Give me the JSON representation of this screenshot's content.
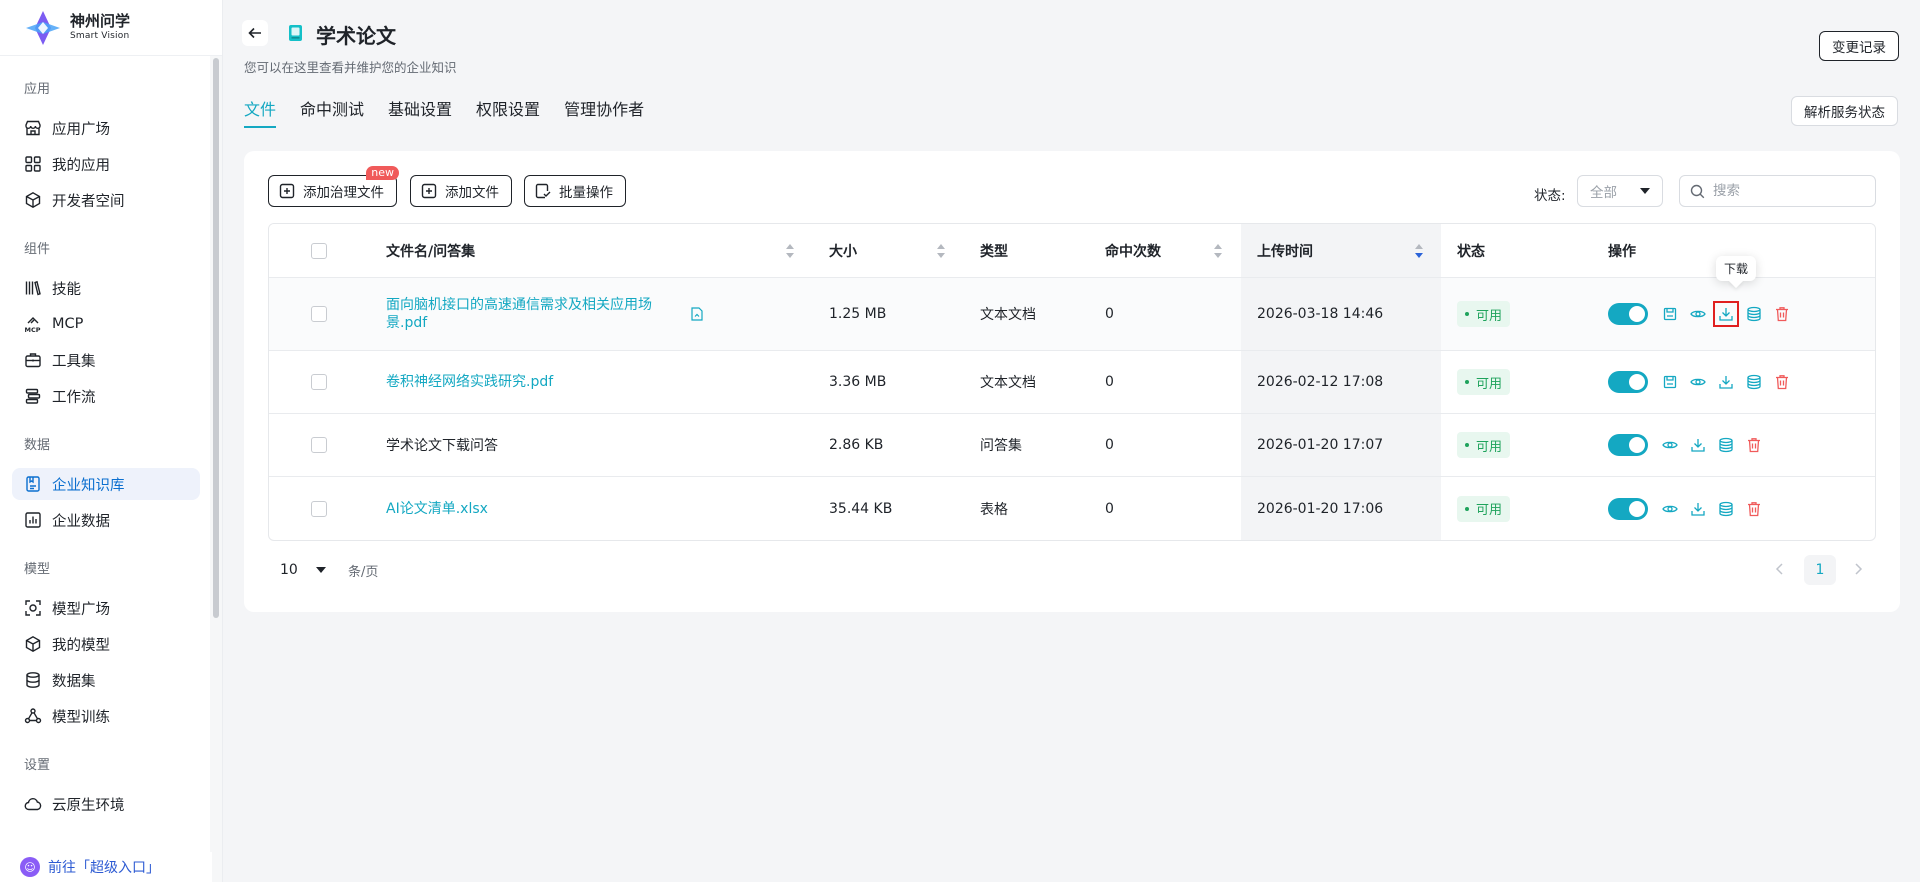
{
  "brand": {
    "name_cn": "神州问学",
    "name_en": "Smart Vision"
  },
  "sidebar": {
    "sections": [
      {
        "title": "应用",
        "items": [
          {
            "label": "应用广场",
            "icon": "store-icon"
          },
          {
            "label": "我的应用",
            "icon": "grid-icon"
          },
          {
            "label": "开发者空间",
            "icon": "cube-icon"
          }
        ]
      },
      {
        "title": "组件",
        "items": [
          {
            "label": "技能",
            "icon": "books-icon"
          },
          {
            "label": "MCP",
            "icon": "mcp-icon"
          },
          {
            "label": "工具集",
            "icon": "toolbox-icon"
          },
          {
            "label": "工作流",
            "icon": "workflow-icon"
          }
        ]
      },
      {
        "title": "数据",
        "items": [
          {
            "label": "企业知识库",
            "icon": "knowledge-icon",
            "active": true
          },
          {
            "label": "企业数据",
            "icon": "chart-icon"
          }
        ]
      },
      {
        "title": "模型",
        "items": [
          {
            "label": "模型广场",
            "icon": "scan-icon"
          },
          {
            "label": "我的模型",
            "icon": "box-icon"
          },
          {
            "label": "数据集",
            "icon": "database-icon"
          },
          {
            "label": "模型训练",
            "icon": "training-icon"
          }
        ]
      },
      {
        "title": "设置",
        "items": [
          {
            "label": "云原生环境",
            "icon": "cloud-icon"
          }
        ]
      }
    ],
    "super_entry": "前往「超级入口」"
  },
  "header": {
    "title": "学术论文",
    "subtitle": "您可以在这里查看并维护您的企业知识",
    "change_log": "变更记录",
    "parse_status": "解析服务状态",
    "tabs": [
      "文件",
      "命中测试",
      "基础设置",
      "权限设置",
      "管理协作者"
    ],
    "active_tab": 0
  },
  "toolbar": {
    "add_governance": "添加治理文件",
    "new_badge": "new",
    "add_file": "添加文件",
    "batch": "批量操作",
    "status_label": "状态:",
    "status_value": "全部",
    "search_placeholder": "搜索"
  },
  "table": {
    "columns": {
      "name": "文件名/问答集",
      "size": "大小",
      "type": "类型",
      "hits": "命中次数",
      "uploaded": "上传时间",
      "status": "状态",
      "ops": "操作"
    },
    "rows": [
      {
        "name": "面向脑机接口的高速通信需求及相关应用场景.pdf",
        "link": true,
        "size": "1.25 MB",
        "type": "文本文档",
        "hits": "0",
        "uploaded": "2026-03-18 14:46",
        "status": "可用"
      },
      {
        "name": "卷积神经网络实践研究.pdf",
        "link": true,
        "size": "3.36 MB",
        "type": "文本文档",
        "hits": "0",
        "uploaded": "2026-02-12 17:08",
        "status": "可用"
      },
      {
        "name": "学术论文下载问答",
        "link": false,
        "size": "2.86 KB",
        "type": "问答集",
        "hits": "0",
        "uploaded": "2026-01-20 17:07",
        "status": "可用"
      },
      {
        "name": "AI论文清单.xlsx",
        "link": true,
        "size": "35.44 KB",
        "type": "表格",
        "hits": "0",
        "uploaded": "2026-01-20 17:06",
        "status": "可用"
      }
    ]
  },
  "tooltip": "下载",
  "pagination": {
    "page_size": "10",
    "unit": "条/页",
    "current": "1"
  },
  "colors": {
    "accent": "#14a8c2",
    "danger": "#f05a5a",
    "success": "#1fa35c"
  }
}
